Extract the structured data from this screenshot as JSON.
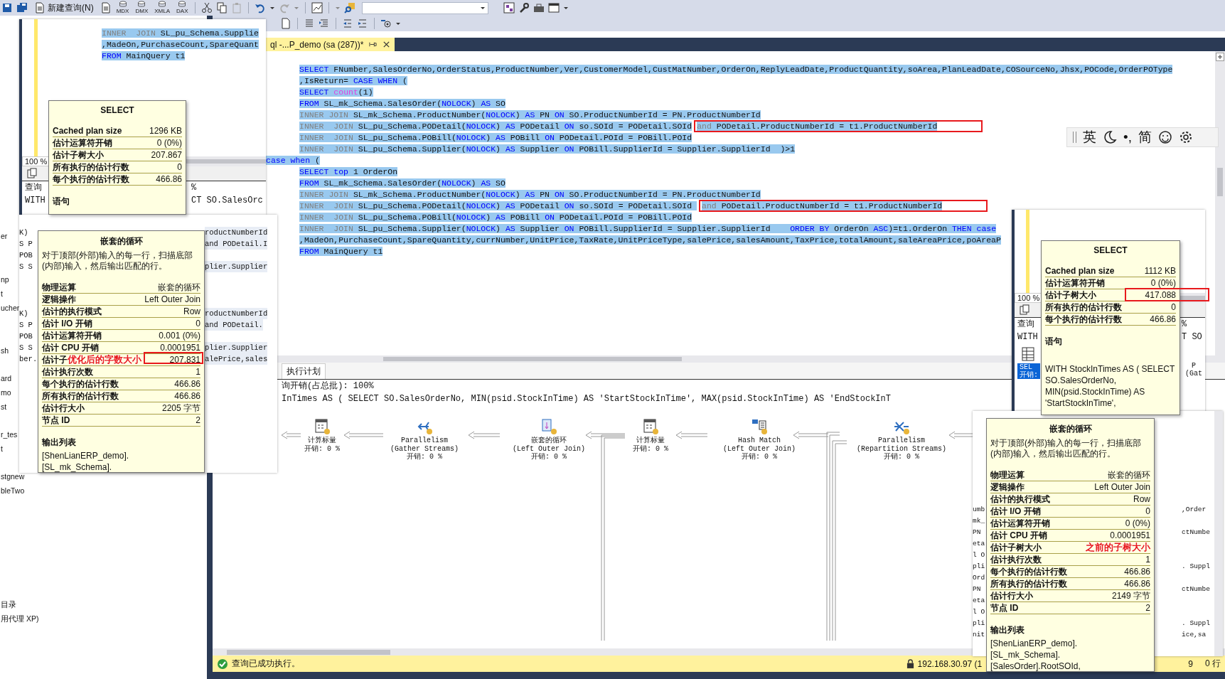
{
  "toolbar": {
    "new_query": "新建查询(N)",
    "query_types": [
      "MDX",
      "DMX",
      "XMLA",
      "DAX"
    ]
  },
  "explorer": {
    "groups": [
      [
        "er"
      ],
      [
        "np",
        "t",
        "ucher"
      ],
      [
        "sh"
      ],
      [
        "ard",
        "mo",
        "st"
      ],
      [
        "r_tes",
        "t"
      ],
      [
        "stgnew",
        "bleTwo"
      ],
      [
        "目录",
        "用代理 XP)"
      ]
    ]
  },
  "editor_tab": {
    "title": "ql -...P_demo (sa (287))*"
  },
  "editor": {
    "lines": [
      {
        "indented": true,
        "tokens": [
          {
            "kind": "kw",
            "text": "SELECT"
          },
          {
            "kind": "plain",
            "text": " FNumber,SalesOrderNo,OrderStatus,ProductNumber,Ver,CustomerModel,CustMatNumber,OrderOn,ReplyLeadDate,ProductQuantity,soArea,PlanLeadDate,COSourceNo,Jhsx,POCode,OrderPOType"
          }
        ]
      },
      {
        "indented": true,
        "tokens": [
          {
            "kind": "plain",
            "text": ",IsReturn= "
          },
          {
            "kind": "kw",
            "text": "CASE WHEN"
          },
          {
            "kind": "plain",
            "text": " ("
          }
        ]
      },
      {
        "indented": true,
        "tokens": [
          {
            "kind": "kw",
            "text": "SELECT"
          },
          {
            "kind": "fn",
            "text": " count"
          },
          {
            "kind": "plain",
            "text": "(1)"
          }
        ]
      },
      {
        "indented": true,
        "tokens": [
          {
            "kind": "kw",
            "text": "FROM"
          },
          {
            "kind": "plain",
            "text": " SL_mk_Schema.SalesOrder("
          },
          {
            "kind": "kw",
            "text": "NOLOCK"
          },
          {
            "kind": "plain",
            "text": ") "
          },
          {
            "kind": "kw",
            "text": "AS"
          },
          {
            "kind": "plain",
            "text": " SO"
          }
        ]
      },
      {
        "indented": true,
        "tokens": [
          {
            "kind": "gray",
            "text": "INNER JOIN"
          },
          {
            "kind": "plain",
            "text": " SL_mk_Schema.ProductNumber("
          },
          {
            "kind": "kw",
            "text": "NOLOCK"
          },
          {
            "kind": "plain",
            "text": ") "
          },
          {
            "kind": "kw",
            "text": "AS"
          },
          {
            "kind": "plain",
            "text": " PN "
          },
          {
            "kind": "kw",
            "text": "ON"
          },
          {
            "kind": "plain",
            "text": " SO.ProductNumberId = PN.ProductNumberId"
          }
        ]
      },
      {
        "indented": true,
        "tokens": [
          {
            "kind": "gray",
            "text": "INNER  JOIN"
          },
          {
            "kind": "plain",
            "text": " SL_pu_Schema.PODetail("
          },
          {
            "kind": "kw",
            "text": "NOLOCK"
          },
          {
            "kind": "plain",
            "text": ") "
          },
          {
            "kind": "kw",
            "text": "AS"
          },
          {
            "kind": "plain",
            "text": " PODetail "
          },
          {
            "kind": "kw",
            "text": "ON"
          },
          {
            "kind": "plain",
            "text": " so.SOId = PODetail.SOId"
          }
        ],
        "boxed": [
          {
            "kind": "gray",
            "text": "and"
          },
          {
            "kind": "plain",
            "text": " PODetail.ProductNumberId = t1.ProductNumberId"
          }
        ]
      },
      {
        "indented": true,
        "tokens": [
          {
            "kind": "gray",
            "text": "INNER  JOIN"
          },
          {
            "kind": "plain",
            "text": " SL_pu_Schema.POBill("
          },
          {
            "kind": "kw",
            "text": "NOLOCK"
          },
          {
            "kind": "plain",
            "text": ") "
          },
          {
            "kind": "kw",
            "text": "AS"
          },
          {
            "kind": "plain",
            "text": " POBill "
          },
          {
            "kind": "kw",
            "text": "ON"
          },
          {
            "kind": "plain",
            "text": " PODetail.POId = POBill.POId"
          }
        ]
      },
      {
        "indented": true,
        "tokens": [
          {
            "kind": "gray",
            "text": "INNER  JOIN"
          },
          {
            "kind": "plain",
            "text": " SL_pu_Schema.Supplier("
          },
          {
            "kind": "kw",
            "text": "NOLOCK"
          },
          {
            "kind": "plain",
            "text": ") "
          },
          {
            "kind": "kw",
            "text": "AS"
          },
          {
            "kind": "plain",
            "text": " Supplier "
          },
          {
            "kind": "kw",
            "text": "ON"
          },
          {
            "kind": "plain",
            "text": " POBill.SupplierId = Supplier.SupplierId  )>1"
          }
        ]
      },
      {
        "indented": false,
        "tokens": [
          {
            "kind": "kw",
            "text": "case when"
          },
          {
            "kind": "plain",
            "text": " ("
          }
        ]
      },
      {
        "indented": true,
        "tokens": [
          {
            "kind": "kw",
            "text": "SELECT top"
          },
          {
            "kind": "plain",
            "text": " 1 OrderOn"
          }
        ]
      },
      {
        "indented": true,
        "tokens": [
          {
            "kind": "kw",
            "text": "FROM"
          },
          {
            "kind": "plain",
            "text": " SL_mk_Schema.SalesOrder("
          },
          {
            "kind": "kw",
            "text": "NOLOCK"
          },
          {
            "kind": "plain",
            "text": ") "
          },
          {
            "kind": "kw",
            "text": "AS"
          },
          {
            "kind": "plain",
            "text": " SO"
          }
        ]
      },
      {
        "indented": true,
        "tokens": [
          {
            "kind": "gray",
            "text": "INNER JOIN"
          },
          {
            "kind": "plain",
            "text": " SL_mk_Schema.ProductNumber("
          },
          {
            "kind": "kw",
            "text": "NOLOCK"
          },
          {
            "kind": "plain",
            "text": ") "
          },
          {
            "kind": "kw",
            "text": "AS"
          },
          {
            "kind": "plain",
            "text": " PN "
          },
          {
            "kind": "kw",
            "text": "ON"
          },
          {
            "kind": "plain",
            "text": " SO.ProductNumberId = PN.ProductNumberId"
          }
        ]
      },
      {
        "indented": true,
        "tokens": [
          {
            "kind": "gray",
            "text": "INNER  JOIN"
          },
          {
            "kind": "plain",
            "text": " SL_pu_Schema.PODetail("
          },
          {
            "kind": "kw",
            "text": "NOLOCK"
          },
          {
            "kind": "plain",
            "text": ") "
          },
          {
            "kind": "kw",
            "text": "AS"
          },
          {
            "kind": "plain",
            "text": " PODetail "
          },
          {
            "kind": "kw",
            "text": "ON"
          },
          {
            "kind": "plain",
            "text": " so.SOId = PODetail.SOId "
          }
        ],
        "boxed": [
          {
            "kind": "gray",
            "text": "and"
          },
          {
            "kind": "plain",
            "text": " PODetail.ProductNumberId = t1.ProductNumberId"
          }
        ]
      },
      {
        "indented": true,
        "tokens": [
          {
            "kind": "gray",
            "text": "INNER  JOIN"
          },
          {
            "kind": "plain",
            "text": " SL_pu_Schema.POBill("
          },
          {
            "kind": "kw",
            "text": "NOLOCK"
          },
          {
            "kind": "plain",
            "text": ") "
          },
          {
            "kind": "kw",
            "text": "AS"
          },
          {
            "kind": "plain",
            "text": " POBill "
          },
          {
            "kind": "kw",
            "text": "ON"
          },
          {
            "kind": "plain",
            "text": " PODetail.POId = POBill.POId"
          }
        ]
      },
      {
        "indented": true,
        "tokens": [
          {
            "kind": "gray",
            "text": "INNER  JOIN"
          },
          {
            "kind": "plain",
            "text": " SL_pu_Schema.Supplier("
          },
          {
            "kind": "kw",
            "text": "NOLOCK"
          },
          {
            "kind": "plain",
            "text": ") "
          },
          {
            "kind": "kw",
            "text": "AS"
          },
          {
            "kind": "plain",
            "text": " Supplier "
          },
          {
            "kind": "kw",
            "text": "ON"
          },
          {
            "kind": "plain",
            "text": " POBill.SupplierId = Supplier.SupplierId    "
          },
          {
            "kind": "kw",
            "text": "ORDER BY"
          },
          {
            "kind": "plain",
            "text": " OrderOn "
          },
          {
            "kind": "kw",
            "text": "ASC"
          },
          {
            "kind": "plain",
            "text": ")=t1.OrderOn "
          },
          {
            "kind": "kw",
            "text": "THEN case"
          }
        ]
      },
      {
        "indented": true,
        "tokens": [
          {
            "kind": "plain",
            "text": ",MadeOn,PurchaseCount,SpareQuantity,currNumber,UnitPrice,TaxRate,UnitPriceType,salePrice,salesAmount,TaxPrice,totalAmount,saleAreaPrice,poAreaP"
          }
        ]
      },
      {
        "indented": true,
        "tokens": [
          {
            "kind": "kw",
            "text": "FROM"
          },
          {
            "kind": "plain",
            "text": " MainQuery t1"
          }
        ]
      }
    ]
  },
  "results": {
    "tab": "执行计划",
    "summary": "询开销(占总批): 100%",
    "statement": "InTimes AS ( SELECT SO.SalesOrderNo, MIN(psid.StockInTime) AS 'StartStockInTime', MAX(psid.StockInTime) AS 'EndStockInT"
  },
  "plan_nodes": [
    {
      "kind": "compute",
      "title": "计算标量",
      "cost": "开销: 0 %"
    },
    {
      "kind": "gather",
      "title": "Parallelism",
      "subtitle": "(Gather Streams)",
      "cost": "开销: 0 %"
    },
    {
      "kind": "loop",
      "title": "嵌套的循环",
      "subtitle": "(Left Outer Join)",
      "cost": "开销: 0 %"
    },
    {
      "kind": "compute",
      "title": "计算标量",
      "cost": "开销: 0 %"
    },
    {
      "kind": "hash",
      "title": "Hash Match",
      "subtitle": "(Left Outer Join)",
      "cost": "开销: 0 %"
    },
    {
      "kind": "repartition",
      "title": "Parallelism",
      "subtitle": "(Repartition Streams)",
      "cost": "开销: 0 %"
    }
  ],
  "status_bar": {
    "message": "查询已成功执行。",
    "server": "192.168.30.97 (1",
    "partial_field": "9",
    "rows": "0 行"
  },
  "window_top_left": {
    "code_lines": [
      {
        "tokens": [
          {
            "kind": "gray",
            "text": "INNER  JOIN"
          },
          {
            "kind": "plain",
            "text": " SL_pu_Schema.Supplie"
          }
        ]
      },
      {
        "tokens": [
          {
            "kind": "plain",
            "text": ",MadeOn,PurchaseCount,SpareQuant"
          }
        ]
      },
      {
        "tokens": [
          {
            "kind": "kw",
            "text": "FROM"
          },
          {
            "kind": "plain",
            "text": " MainQuery t1"
          }
        ]
      }
    ],
    "zoom": "100 %",
    "result_lines": [
      {
        "left": "查询",
        "right": "%"
      },
      {
        "left": "WITH",
        "right": "CT SO.SalesOrc"
      }
    ]
  },
  "window_left": {
    "groups": [
      [
        {
          "left": "K)",
          "right": "roductNumberId"
        },
        {
          "left": "S P",
          "right": "and PODetail.I"
        },
        {
          "left": "POB"
        },
        {
          "left": "S S",
          "right": "plier.Supplier"
        }
      ],
      [
        {
          "left": "K)",
          "right": "roductNumberId"
        },
        {
          "left": "S P",
          "right": "and PODetail."
        },
        {
          "left": "POB"
        },
        {
          "left": "S S",
          "right": "plier.Supplier"
        },
        {
          "left": "ber.",
          "right": "alePrice,sales"
        }
      ]
    ]
  },
  "window_right": {
    "zoom": "100 %",
    "result_lines": [
      {
        "left": "查询",
        "right": "%"
      },
      {
        "left": "WITH",
        "right": "T SO"
      }
    ],
    "node": {
      "title": "SEL",
      "cost": "开销:"
    },
    "edge_labels": [
      "P",
      "(Gat"
    ]
  },
  "window_bottom_right": {
    "lines": [
      {
        "left": "umb",
        "right": ",Order"
      },
      {
        "left": "mk_"
      },
      {
        "left": "PN",
        "right": "ctNumbe"
      },
      {
        "left": "eta"
      },
      {
        "left": "l O"
      },
      {
        "left": "pli",
        "right": ". Suppl"
      },
      {
        "left": "Ord"
      },
      {
        "left": "PN",
        "right": "ctNumbe"
      },
      {
        "left": "eta"
      },
      {
        "left": "l O"
      },
      {
        "left": "pli",
        "right": ". Suppl"
      },
      {
        "left": "nit",
        "right": "ice,sa"
      }
    ]
  },
  "tooltips": [
    {
      "title": "SELECT",
      "rows": [
        {
          "label": "Cached plan size",
          "value": "1296 KB"
        },
        {
          "label": "估计运算符开销",
          "value": "0 (0%)"
        },
        {
          "label": "估计子树大小",
          "value": "207.867"
        },
        {
          "label": "所有执行的估计行数",
          "value": "0"
        },
        {
          "label": "每个执行的估计行数",
          "value": "466.86"
        }
      ],
      "sections": [
        {
          "heading": "语句"
        }
      ]
    },
    {
      "title": "嵌套的循环",
      "description": "对于顶部(外部)输入的每一行，扫描底部(内部)输入，然后输出匹配的行。",
      "rows": [
        {
          "label": "物理运算",
          "value": "嵌套的循环"
        },
        {
          "label": "逻辑操作",
          "value": "Left Outer Join"
        },
        {
          "label": "估计的执行模式",
          "value": "Row"
        },
        {
          "label": "估计 I/O 开销",
          "value": "0"
        },
        {
          "label": "估计运算符开销",
          "value": "0.001 (0%)"
        },
        {
          "label": "估计 CPU 开销",
          "value": "0.0001951"
        },
        {
          "label": "估计子",
          "annotation": "优化后的字数大小",
          "value": "207.831"
        },
        {
          "label": "估计执行次数",
          "value": "1"
        },
        {
          "label": "每个执行的估计行数",
          "value": "466.86"
        },
        {
          "label": "所有执行的估计行数",
          "value": "466.86"
        },
        {
          "label": "估计行大小",
          "value": "2205 字节"
        },
        {
          "label": "节点 ID",
          "value": "2"
        }
      ],
      "sections": [
        {
          "heading": "输出列表",
          "lines": [
            "[ShenLianERP_demo].",
            "[SL_mk_Schema]."
          ]
        }
      ]
    },
    {
      "title": "SELECT",
      "rows": [
        {
          "label": "Cached plan size",
          "value": "1112 KB"
        },
        {
          "label": "估计运算符开销",
          "value": "0 (0%)"
        },
        {
          "label": "估计子树大小",
          "value": "417.088"
        },
        {
          "label": "所有执行的估计行数",
          "value": "0"
        },
        {
          "label": "每个执行的估计行数",
          "value": "466.86"
        }
      ],
      "sections": [
        {
          "heading": "语句",
          "lines": [
            "WITH StockInTimes AS ( SELECT  SO.SalesOrderNo, MIN(psid.StockInTime) AS 'StartStockInTime',"
          ]
        }
      ]
    },
    {
      "title": "嵌套的循环",
      "description": "对于顶部(外部)输入的每一行，扫描底部(内部)输入，然后输出匹配的行。",
      "rows": [
        {
          "label": "物理运算",
          "value": "嵌套的循环"
        },
        {
          "label": "逻辑操作",
          "value": "Left Outer Join"
        },
        {
          "label": "估计的执行模式",
          "value": "Row"
        },
        {
          "label": "估计 I/O 开销",
          "value": "0"
        },
        {
          "label": "估计运算符开销",
          "value": "0 (0%)"
        },
        {
          "label": "估计 CPU 开销",
          "value": "0.0001951"
        },
        {
          "label": "估计子树大小",
          "annotation": "之前的子树大小"
        },
        {
          "label": "估计执行次数",
          "value": "1"
        },
        {
          "label": "每个执行的估计行数",
          "value": "466.86"
        },
        {
          "label": "所有执行的估计行数",
          "value": "466.86"
        },
        {
          "label": "估计行大小",
          "value": "2149 字节"
        },
        {
          "label": "节点 ID",
          "value": "2"
        }
      ],
      "sections": [
        {
          "heading": "输出列表",
          "lines": [
            "[ShenLianERP_demo].",
            "[SL_mk_Schema].",
            "[SalesOrder].RootSOId,"
          ]
        }
      ]
    }
  ],
  "ime_bar": {
    "language": "英",
    "punctuation": "•,",
    "script": "简"
  }
}
